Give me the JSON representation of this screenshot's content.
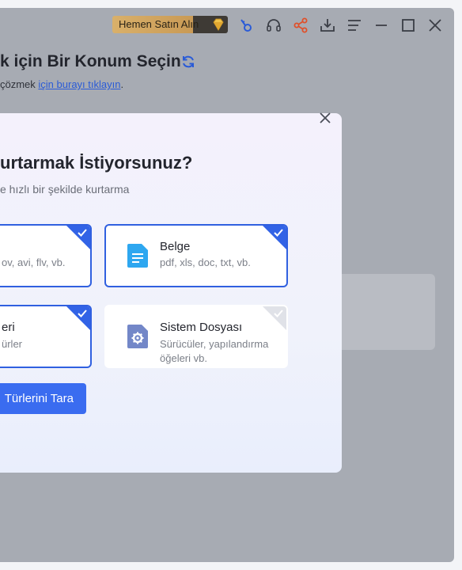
{
  "titlebar": {
    "buy_label": "Hemen Satın Alın",
    "icons": [
      "key-icon",
      "headset-icon",
      "share-icon",
      "download-icon",
      "menu-icon",
      "minimize-icon",
      "maximize-icon",
      "close-icon"
    ]
  },
  "page": {
    "heading": "k için Bir Konum Seçin",
    "sub_prefix": "çözmek ",
    "sub_link": "için burayı tıklayın",
    "sub_suffix": "."
  },
  "modal": {
    "title": "urtarmak İstiyorsunuz?",
    "subtitle": "e hızlı bir şekilde kurtarma",
    "cards": [
      {
        "title": "",
        "desc": "ov, avi, flv, vb.",
        "checked": true
      },
      {
        "title": "Belge",
        "desc": "pdf, xls, doc, txt, vb.",
        "checked": true
      },
      {
        "title": "eri",
        "desc": "ürler",
        "checked": true
      },
      {
        "title": "Sistem Dosyası",
        "desc_line1": "Sürücüler, yapılandırma",
        "desc_line2": "öğeleri vb.",
        "checked": false
      }
    ],
    "scan_button": "Türlerini Tara"
  },
  "colors": {
    "accent": "#3263e6",
    "buy_gold": "#d9b06a",
    "overlay": "#a7abb3"
  }
}
